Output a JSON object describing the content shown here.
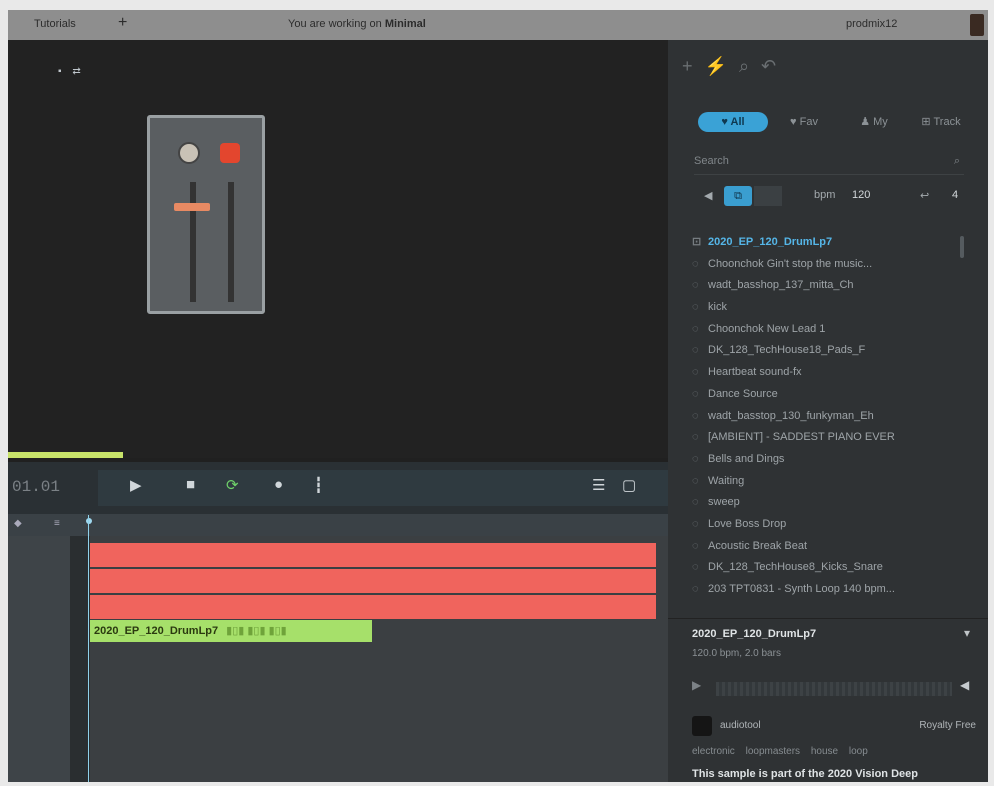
{
  "topbar": {
    "tab_label": "Tutorials",
    "add_label": "+",
    "working_prefix": "You are working on",
    "working_project": "Minimal",
    "username": "prodmix12"
  },
  "stage": {
    "view_icons": "▪ ⇄"
  },
  "transport": {
    "position": "01.01",
    "play": "▶",
    "stop": "■",
    "loop": "⟳",
    "record": "●",
    "mixer": "┇",
    "rack": "☰",
    "folder": "▢"
  },
  "ruler": {
    "left1": "◆",
    "left2": "≡"
  },
  "clips": {
    "green_label": "2020_EP_120_DrumLp7",
    "green_wave": "▮▯▮ ▮▯▮ ▮▯▮"
  },
  "panel": {
    "filters": [
      "♥ All",
      "♥ Fav",
      "♟ My",
      "⊞ Track"
    ],
    "search_placeholder": "Search",
    "search_icon": "⌕",
    "ctrl_icon": "◀",
    "ctrl_btn": "⧉",
    "bpm_label": "bpm",
    "bpm_value": "120",
    "key_icon": "↩",
    "key_value": "4",
    "items": [
      "2020_EP_120_DrumLp7",
      "Choonchok Gin't stop the music...",
      "wadt_basshop_137_mitta_Ch",
      "kick",
      "Choonchok New Lead 1",
      "DK_128_TechHouse18_Pads_F",
      "Heartbeat sound-fx",
      "Dance Source",
      "wadt_basstop_130_funkyman_Eh",
      "[AMBIENT] - SADDEST PIANO EVER",
      "Bells and Dings",
      "Waiting",
      "sweep",
      "Love Boss Drop",
      "Acoustic Break Beat",
      "DK_128_TechHouse8_Kicks_Snare",
      "203 TPT0831 - Synth Loop 140 bpm..."
    ],
    "selected_title": "2020_EP_120_DrumLp7",
    "selected_info": "120.0 bpm, 2.0 bars",
    "selected_toggle": "▾",
    "player_play": "▶",
    "player_speaker": "◀",
    "author": "audiotool",
    "license": "Royalty Free",
    "tags": [
      "electronic",
      "loopmasters",
      "house",
      "loop"
    ],
    "description": "This sample is part of the 2020 Vision Deep"
  },
  "colors": {
    "accent_blue": "#3aa2d6",
    "clip_red": "#f0645d",
    "clip_green": "#a6e06a",
    "record_red": "#e3462e"
  }
}
